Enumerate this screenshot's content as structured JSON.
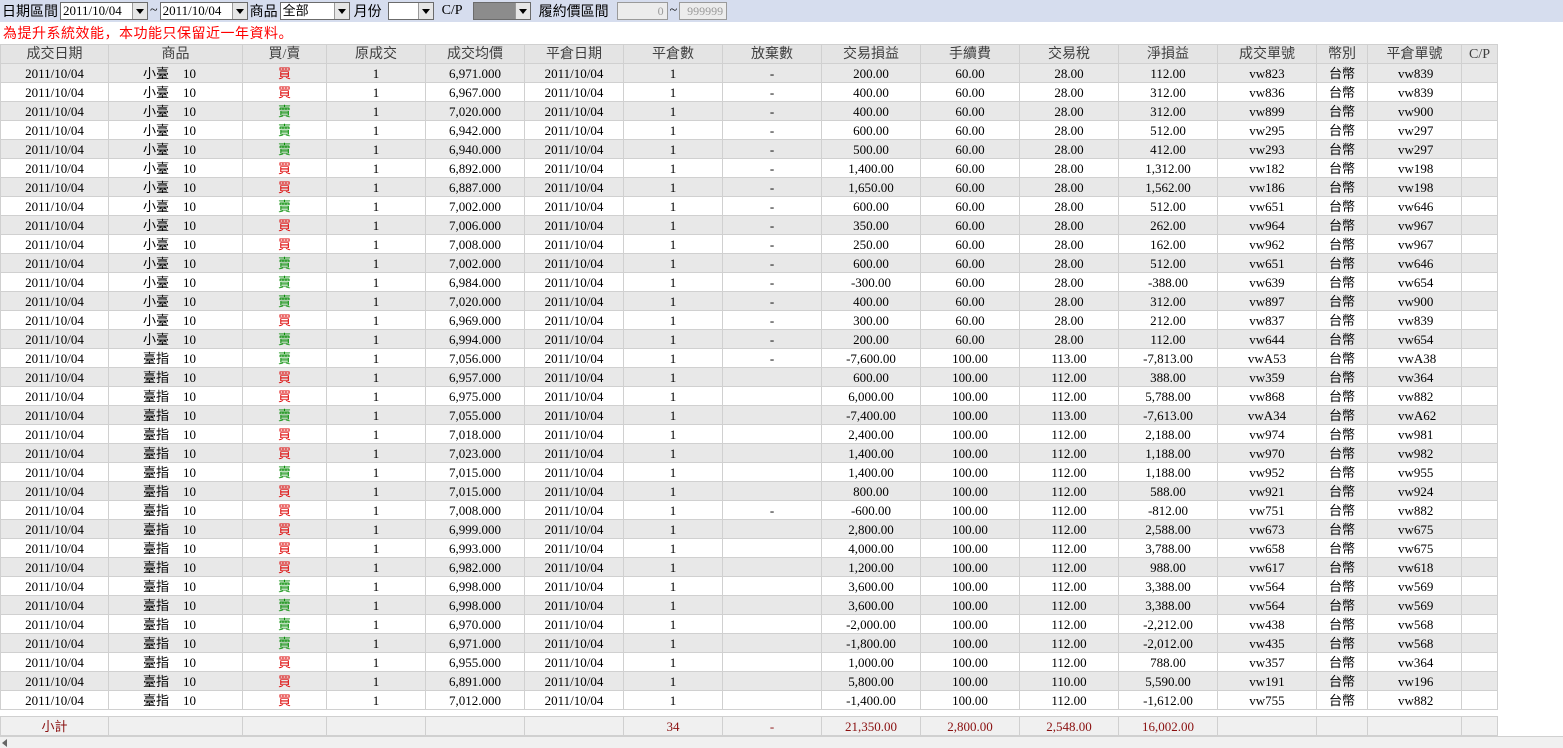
{
  "toolbar": {
    "date_range_label": "日期區間",
    "date_from": "2011/10/04",
    "tilde": "~",
    "date_to": "2011/10/04",
    "product_label": "商品",
    "product_value": "全部",
    "month_label": "月份",
    "month_value": "",
    "cp_label": "C/P",
    "cp_value": "",
    "strike_label": "履約價區間",
    "strike_from": "0",
    "strike_to": "999999"
  },
  "notice": "為提升系統效能，本功能只保留近一年資料。",
  "columns": [
    "成交日期",
    "商品",
    "買/賣",
    "原成交",
    "成交均價",
    "平倉日期",
    "平倉數",
    "放棄數",
    "交易損益",
    "手續費",
    "交易稅",
    "淨損益",
    "成交單號",
    "幣別",
    "平倉單號",
    "C/P"
  ],
  "rows": [
    [
      "2011/10/04",
      "小臺",
      "10",
      "買",
      "1",
      "6,971.000",
      "2011/10/04",
      "1",
      "-",
      "200.00",
      "60.00",
      "28.00",
      "112.00",
      "vw823",
      "台幣",
      "vw839",
      ""
    ],
    [
      "2011/10/04",
      "小臺",
      "10",
      "買",
      "1",
      "6,967.000",
      "2011/10/04",
      "1",
      "-",
      "400.00",
      "60.00",
      "28.00",
      "312.00",
      "vw836",
      "台幣",
      "vw839",
      ""
    ],
    [
      "2011/10/04",
      "小臺",
      "10",
      "賣",
      "1",
      "7,020.000",
      "2011/10/04",
      "1",
      "-",
      "400.00",
      "60.00",
      "28.00",
      "312.00",
      "vw899",
      "台幣",
      "vw900",
      ""
    ],
    [
      "2011/10/04",
      "小臺",
      "10",
      "賣",
      "1",
      "6,942.000",
      "2011/10/04",
      "1",
      "-",
      "600.00",
      "60.00",
      "28.00",
      "512.00",
      "vw295",
      "台幣",
      "vw297",
      ""
    ],
    [
      "2011/10/04",
      "小臺",
      "10",
      "賣",
      "1",
      "6,940.000",
      "2011/10/04",
      "1",
      "-",
      "500.00",
      "60.00",
      "28.00",
      "412.00",
      "vw293",
      "台幣",
      "vw297",
      ""
    ],
    [
      "2011/10/04",
      "小臺",
      "10",
      "買",
      "1",
      "6,892.000",
      "2011/10/04",
      "1",
      "-",
      "1,400.00",
      "60.00",
      "28.00",
      "1,312.00",
      "vw182",
      "台幣",
      "vw198",
      ""
    ],
    [
      "2011/10/04",
      "小臺",
      "10",
      "買",
      "1",
      "6,887.000",
      "2011/10/04",
      "1",
      "-",
      "1,650.00",
      "60.00",
      "28.00",
      "1,562.00",
      "vw186",
      "台幣",
      "vw198",
      ""
    ],
    [
      "2011/10/04",
      "小臺",
      "10",
      "賣",
      "1",
      "7,002.000",
      "2011/10/04",
      "1",
      "-",
      "600.00",
      "60.00",
      "28.00",
      "512.00",
      "vw651",
      "台幣",
      "vw646",
      ""
    ],
    [
      "2011/10/04",
      "小臺",
      "10",
      "買",
      "1",
      "7,006.000",
      "2011/10/04",
      "1",
      "-",
      "350.00",
      "60.00",
      "28.00",
      "262.00",
      "vw964",
      "台幣",
      "vw967",
      ""
    ],
    [
      "2011/10/04",
      "小臺",
      "10",
      "買",
      "1",
      "7,008.000",
      "2011/10/04",
      "1",
      "-",
      "250.00",
      "60.00",
      "28.00",
      "162.00",
      "vw962",
      "台幣",
      "vw967",
      ""
    ],
    [
      "2011/10/04",
      "小臺",
      "10",
      "賣",
      "1",
      "7,002.000",
      "2011/10/04",
      "1",
      "-",
      "600.00",
      "60.00",
      "28.00",
      "512.00",
      "vw651",
      "台幣",
      "vw646",
      ""
    ],
    [
      "2011/10/04",
      "小臺",
      "10",
      "賣",
      "1",
      "6,984.000",
      "2011/10/04",
      "1",
      "-",
      "-300.00",
      "60.00",
      "28.00",
      "-388.00",
      "vw639",
      "台幣",
      "vw654",
      ""
    ],
    [
      "2011/10/04",
      "小臺",
      "10",
      "賣",
      "1",
      "7,020.000",
      "2011/10/04",
      "1",
      "-",
      "400.00",
      "60.00",
      "28.00",
      "312.00",
      "vw897",
      "台幣",
      "vw900",
      ""
    ],
    [
      "2011/10/04",
      "小臺",
      "10",
      "買",
      "1",
      "6,969.000",
      "2011/10/04",
      "1",
      "-",
      "300.00",
      "60.00",
      "28.00",
      "212.00",
      "vw837",
      "台幣",
      "vw839",
      ""
    ],
    [
      "2011/10/04",
      "小臺",
      "10",
      "賣",
      "1",
      "6,994.000",
      "2011/10/04",
      "1",
      "-",
      "200.00",
      "60.00",
      "28.00",
      "112.00",
      "vw644",
      "台幣",
      "vw654",
      ""
    ],
    [
      "2011/10/04",
      "臺指",
      "10",
      "賣",
      "1",
      "7,056.000",
      "2011/10/04",
      "1",
      "-",
      "-7,600.00",
      "100.00",
      "113.00",
      "-7,813.00",
      "vwA53",
      "台幣",
      "vwA38",
      ""
    ],
    [
      "2011/10/04",
      "臺指",
      "10",
      "買",
      "1",
      "6,957.000",
      "2011/10/04",
      "1",
      "",
      "600.00",
      "100.00",
      "112.00",
      "388.00",
      "vw359",
      "台幣",
      "vw364",
      ""
    ],
    [
      "2011/10/04",
      "臺指",
      "10",
      "買",
      "1",
      "6,975.000",
      "2011/10/04",
      "1",
      "",
      "6,000.00",
      "100.00",
      "112.00",
      "5,788.00",
      "vw868",
      "台幣",
      "vw882",
      ""
    ],
    [
      "2011/10/04",
      "臺指",
      "10",
      "賣",
      "1",
      "7,055.000",
      "2011/10/04",
      "1",
      "",
      "-7,400.00",
      "100.00",
      "113.00",
      "-7,613.00",
      "vwA34",
      "台幣",
      "vwA62",
      ""
    ],
    [
      "2011/10/04",
      "臺指",
      "10",
      "買",
      "1",
      "7,018.000",
      "2011/10/04",
      "1",
      "",
      "2,400.00",
      "100.00",
      "112.00",
      "2,188.00",
      "vw974",
      "台幣",
      "vw981",
      ""
    ],
    [
      "2011/10/04",
      "臺指",
      "10",
      "買",
      "1",
      "7,023.000",
      "2011/10/04",
      "1",
      "",
      "1,400.00",
      "100.00",
      "112.00",
      "1,188.00",
      "vw970",
      "台幣",
      "vw982",
      ""
    ],
    [
      "2011/10/04",
      "臺指",
      "10",
      "賣",
      "1",
      "7,015.000",
      "2011/10/04",
      "1",
      "",
      "1,400.00",
      "100.00",
      "112.00",
      "1,188.00",
      "vw952",
      "台幣",
      "vw955",
      ""
    ],
    [
      "2011/10/04",
      "臺指",
      "10",
      "買",
      "1",
      "7,015.000",
      "2011/10/04",
      "1",
      "",
      "800.00",
      "100.00",
      "112.00",
      "588.00",
      "vw921",
      "台幣",
      "vw924",
      ""
    ],
    [
      "2011/10/04",
      "臺指",
      "10",
      "買",
      "1",
      "7,008.000",
      "2011/10/04",
      "1",
      "-",
      "-600.00",
      "100.00",
      "112.00",
      "-812.00",
      "vw751",
      "台幣",
      "vw882",
      ""
    ],
    [
      "2011/10/04",
      "臺指",
      "10",
      "買",
      "1",
      "6,999.000",
      "2011/10/04",
      "1",
      "",
      "2,800.00",
      "100.00",
      "112.00",
      "2,588.00",
      "vw673",
      "台幣",
      "vw675",
      ""
    ],
    [
      "2011/10/04",
      "臺指",
      "10",
      "買",
      "1",
      "6,993.000",
      "2011/10/04",
      "1",
      "",
      "4,000.00",
      "100.00",
      "112.00",
      "3,788.00",
      "vw658",
      "台幣",
      "vw675",
      ""
    ],
    [
      "2011/10/04",
      "臺指",
      "10",
      "買",
      "1",
      "6,982.000",
      "2011/10/04",
      "1",
      "",
      "1,200.00",
      "100.00",
      "112.00",
      "988.00",
      "vw617",
      "台幣",
      "vw618",
      ""
    ],
    [
      "2011/10/04",
      "臺指",
      "10",
      "賣",
      "1",
      "6,998.000",
      "2011/10/04",
      "1",
      "",
      "3,600.00",
      "100.00",
      "112.00",
      "3,388.00",
      "vw564",
      "台幣",
      "vw569",
      ""
    ],
    [
      "2011/10/04",
      "臺指",
      "10",
      "賣",
      "1",
      "6,998.000",
      "2011/10/04",
      "1",
      "",
      "3,600.00",
      "100.00",
      "112.00",
      "3,388.00",
      "vw564",
      "台幣",
      "vw569",
      ""
    ],
    [
      "2011/10/04",
      "臺指",
      "10",
      "賣",
      "1",
      "6,970.000",
      "2011/10/04",
      "1",
      "",
      "-2,000.00",
      "100.00",
      "112.00",
      "-2,212.00",
      "vw438",
      "台幣",
      "vw568",
      ""
    ],
    [
      "2011/10/04",
      "臺指",
      "10",
      "賣",
      "1",
      "6,971.000",
      "2011/10/04",
      "1",
      "",
      "-1,800.00",
      "100.00",
      "112.00",
      "-2,012.00",
      "vw435",
      "台幣",
      "vw568",
      ""
    ],
    [
      "2011/10/04",
      "臺指",
      "10",
      "買",
      "1",
      "6,955.000",
      "2011/10/04",
      "1",
      "",
      "1,000.00",
      "100.00",
      "112.00",
      "788.00",
      "vw357",
      "台幣",
      "vw364",
      ""
    ],
    [
      "2011/10/04",
      "臺指",
      "10",
      "買",
      "1",
      "6,891.000",
      "2011/10/04",
      "1",
      "",
      "5,800.00",
      "100.00",
      "110.00",
      "5,590.00",
      "vw191",
      "台幣",
      "vw196",
      ""
    ],
    [
      "2011/10/04",
      "臺指",
      "10",
      "買",
      "1",
      "7,012.000",
      "2011/10/04",
      "1",
      "",
      "-1,400.00",
      "100.00",
      "112.00",
      "-1,612.00",
      "vw755",
      "台幣",
      "vw882",
      ""
    ]
  ],
  "total": {
    "label": "小計",
    "close_qty": "34",
    "abandon_qty": "-",
    "trade_pnl": "21,350.00",
    "fee": "2,800.00",
    "tax": "2,548.00",
    "net_pnl": "16,002.00"
  },
  "colors": {
    "buy": "#dd0000",
    "sell": "#008a00",
    "total_text": "#8a1010",
    "notice": "#ff0000",
    "toolbar_bg": "#d6ddee"
  }
}
